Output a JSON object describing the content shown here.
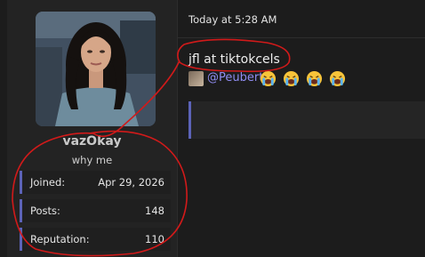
{
  "user": {
    "name": "vazOkay",
    "title": "why me",
    "stats": [
      {
        "label": "Joined:",
        "value": "Apr 29, 2026"
      },
      {
        "label": "Posts:",
        "value": "148"
      },
      {
        "label": "Reputation:",
        "value": "110"
      }
    ]
  },
  "post": {
    "timestamp": "Today at 5:28 AM",
    "text": "jfl at tiktokcels",
    "mention": "@Peubert",
    "emoji_icon": "loudly-crying-face-icon",
    "emoji_count": 4
  },
  "colors": {
    "accent": "#5c63b8",
    "mention": "#8f8cf0",
    "annotation": "#d11a1a"
  }
}
